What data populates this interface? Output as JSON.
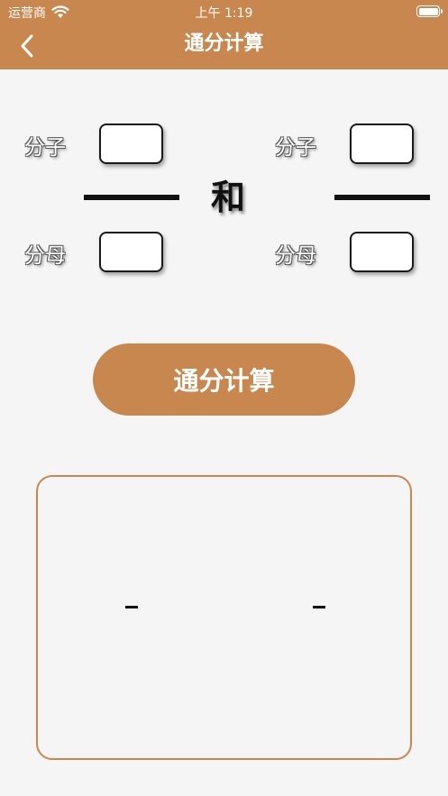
{
  "status": {
    "carrier": "运营商",
    "time": "上午 1:19"
  },
  "nav": {
    "title": "通分计算"
  },
  "fraction_left": {
    "numerator_label": "分子",
    "denominator_label": "分母",
    "numerator_value": "",
    "denominator_value": ""
  },
  "connector": "和",
  "fraction_right": {
    "numerator_label": "分子",
    "denominator_label": "分母",
    "numerator_value": "",
    "denominator_value": ""
  },
  "button": {
    "label": "通分计算"
  },
  "colors": {
    "accent": "#c8874e",
    "background": "#f5f5f5"
  },
  "icons": {
    "back": "chevron-left-icon",
    "wifi": "wifi-icon",
    "battery": "battery-icon"
  }
}
